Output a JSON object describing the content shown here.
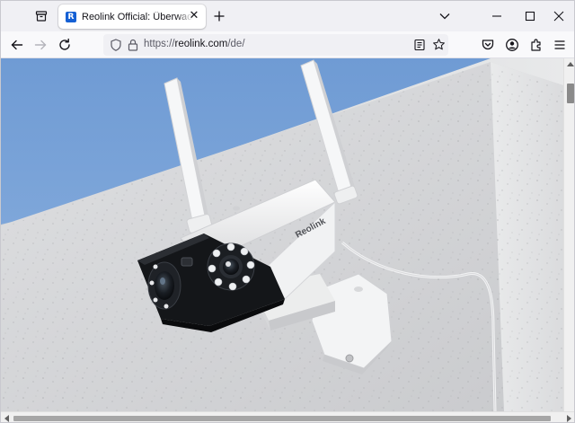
{
  "browser": {
    "tab": {
      "title": "Reolink Official: Überwachungskameras",
      "favicon_letter": "R",
      "favicon_color": "#1560d4"
    },
    "url": {
      "protocol": "https://",
      "host": "reolink.com",
      "path": "/de/"
    },
    "accent_color": "#0061e0"
  },
  "page": {
    "hero_image": {
      "subject": "Reolink dual-lens wireless security camera mounted on a white concrete wall",
      "brand_mark": "Reolink"
    }
  },
  "icons": [
    "tab-list-icon",
    "close-icon",
    "plus-icon",
    "chevron-down-icon",
    "minimize-icon",
    "maximize-icon",
    "window-close-icon",
    "back-arrow-icon",
    "forward-arrow-icon",
    "reload-icon",
    "shield-icon",
    "lock-icon",
    "reader-view-icon",
    "bookmark-star-icon",
    "pocket-icon",
    "account-icon",
    "extensions-icon",
    "menu-icon"
  ]
}
